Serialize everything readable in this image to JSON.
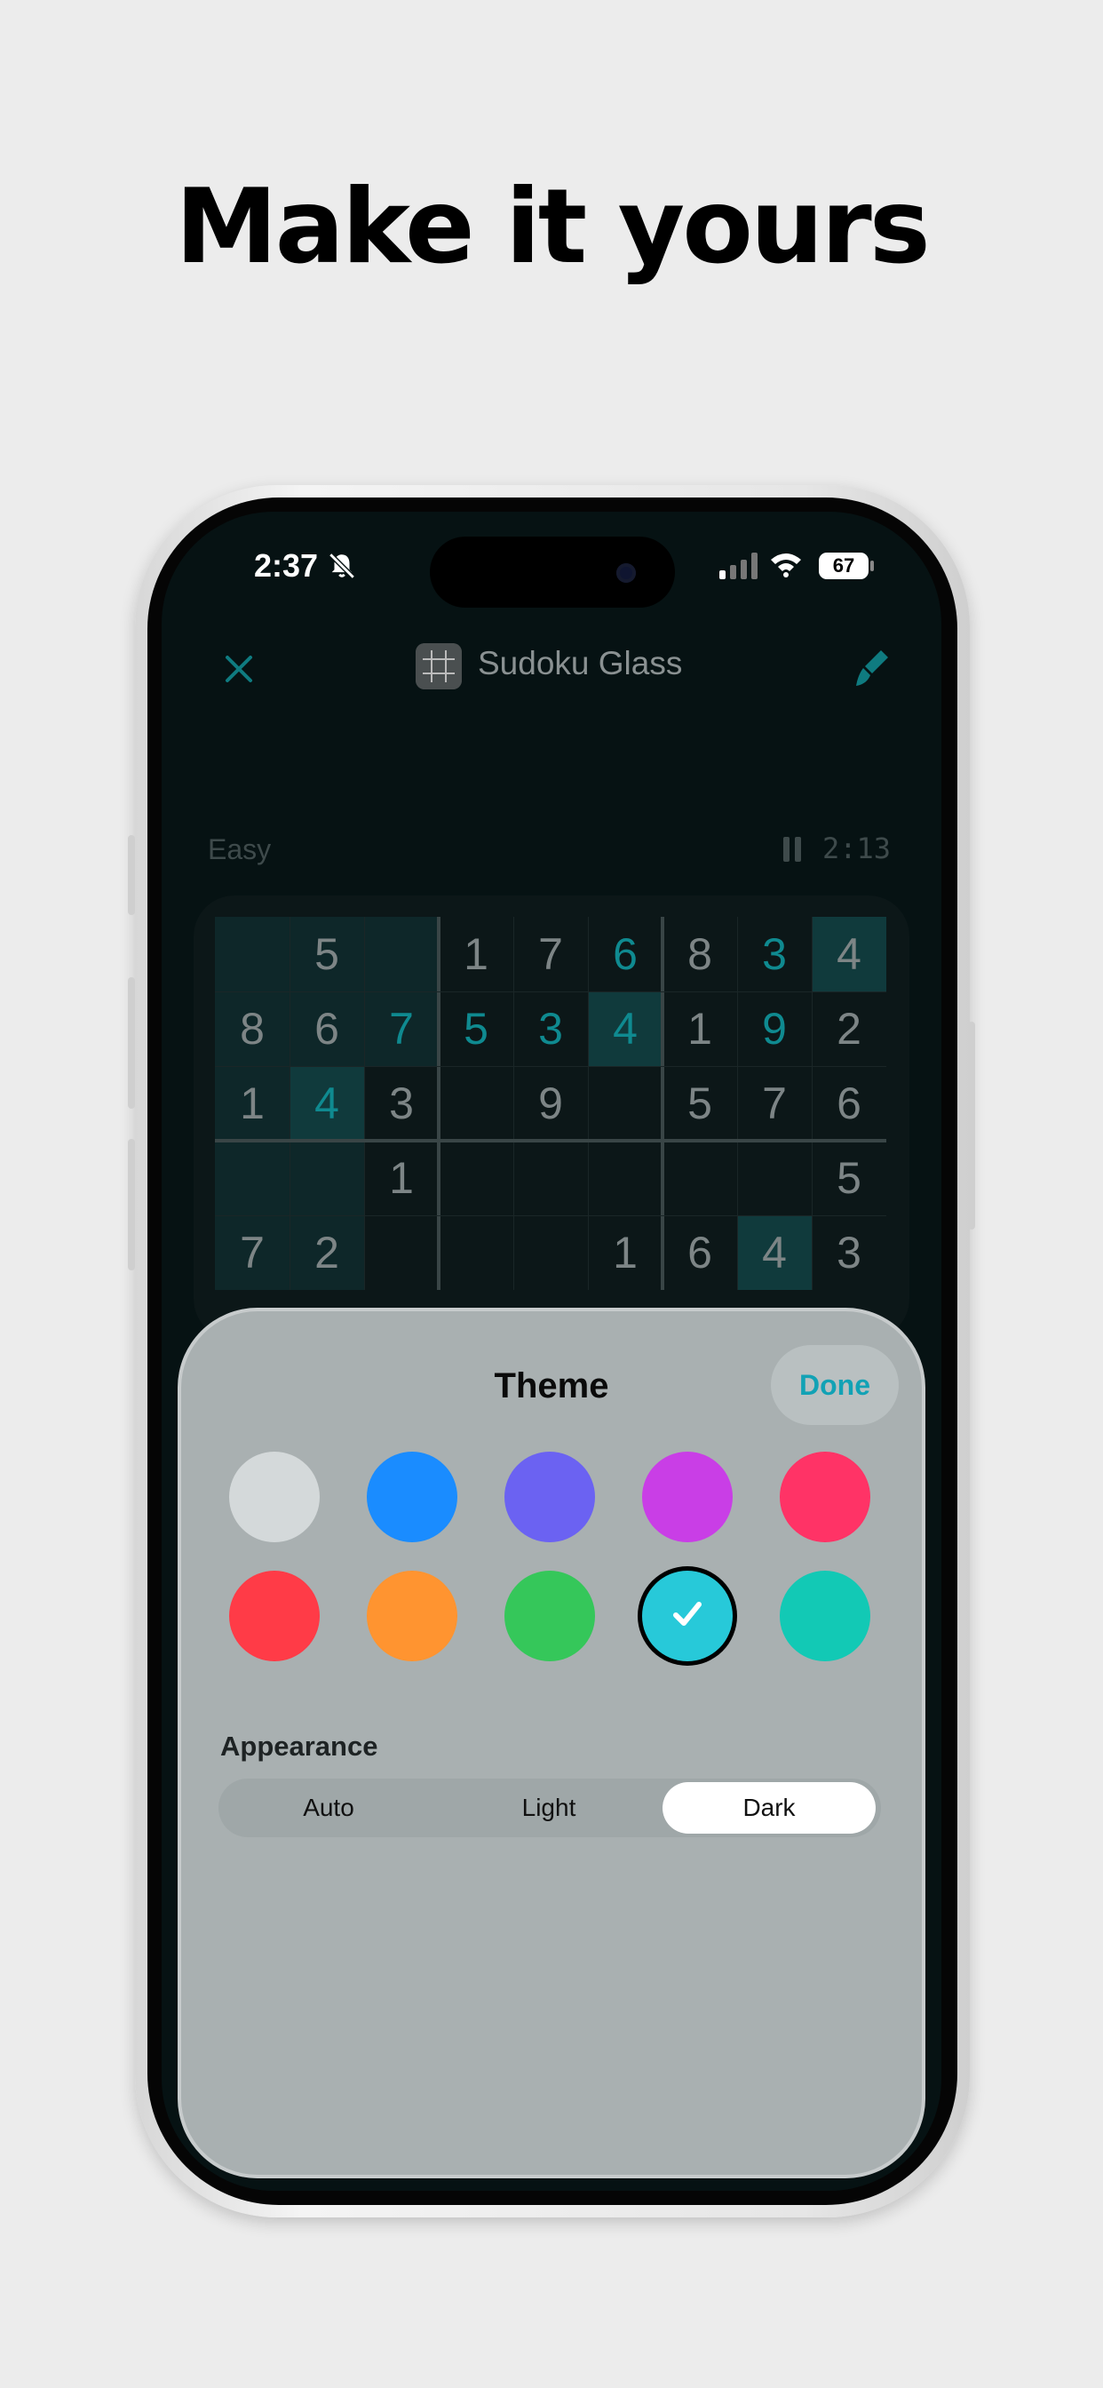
{
  "headline": "Make it yours",
  "status_bar": {
    "time": "2:37",
    "battery": "67",
    "icons": [
      "bell-slash-icon",
      "signal-icon",
      "wifi-icon",
      "battery-icon"
    ]
  },
  "nav": {
    "title": "Sudoku Glass",
    "close_icon": "close-icon",
    "theme_icon": "paintbrush-icon"
  },
  "game": {
    "difficulty": "Easy",
    "timer": "2:13",
    "rows": [
      [
        "",
        "5",
        "",
        "1",
        "7",
        "6",
        "8",
        "3",
        "4"
      ],
      [
        "8",
        "6",
        "7",
        "5",
        "3",
        "4",
        "1",
        "9",
        "2"
      ],
      [
        "1",
        "4",
        "3",
        "",
        "9",
        "",
        "5",
        "7",
        "6"
      ],
      [
        "",
        "",
        "1",
        "",
        "",
        "",
        "",
        "",
        "5"
      ],
      [
        "7",
        "2",
        "",
        "",
        "",
        "1",
        "6",
        "4",
        "3"
      ]
    ],
    "user_entries": [
      [
        0,
        5
      ],
      [
        0,
        7
      ],
      [
        1,
        2
      ],
      [
        1,
        3
      ],
      [
        1,
        4
      ],
      [
        1,
        5
      ],
      [
        1,
        7
      ],
      [
        2,
        1
      ]
    ]
  },
  "theme_sheet": {
    "title": "Theme",
    "done_label": "Done",
    "colors": [
      "#d4d9da",
      "#1a8cff",
      "#6b62f2",
      "#c93ee6",
      "#ff3366",
      "#ff3b47",
      "#ff9430",
      "#35c75a",
      "#27c9d9",
      "#12c9b5"
    ],
    "selected_index": 8,
    "appearance_label": "Appearance",
    "appearance_options": [
      "Auto",
      "Light",
      "Dark"
    ],
    "appearance_selected": "Dark"
  }
}
